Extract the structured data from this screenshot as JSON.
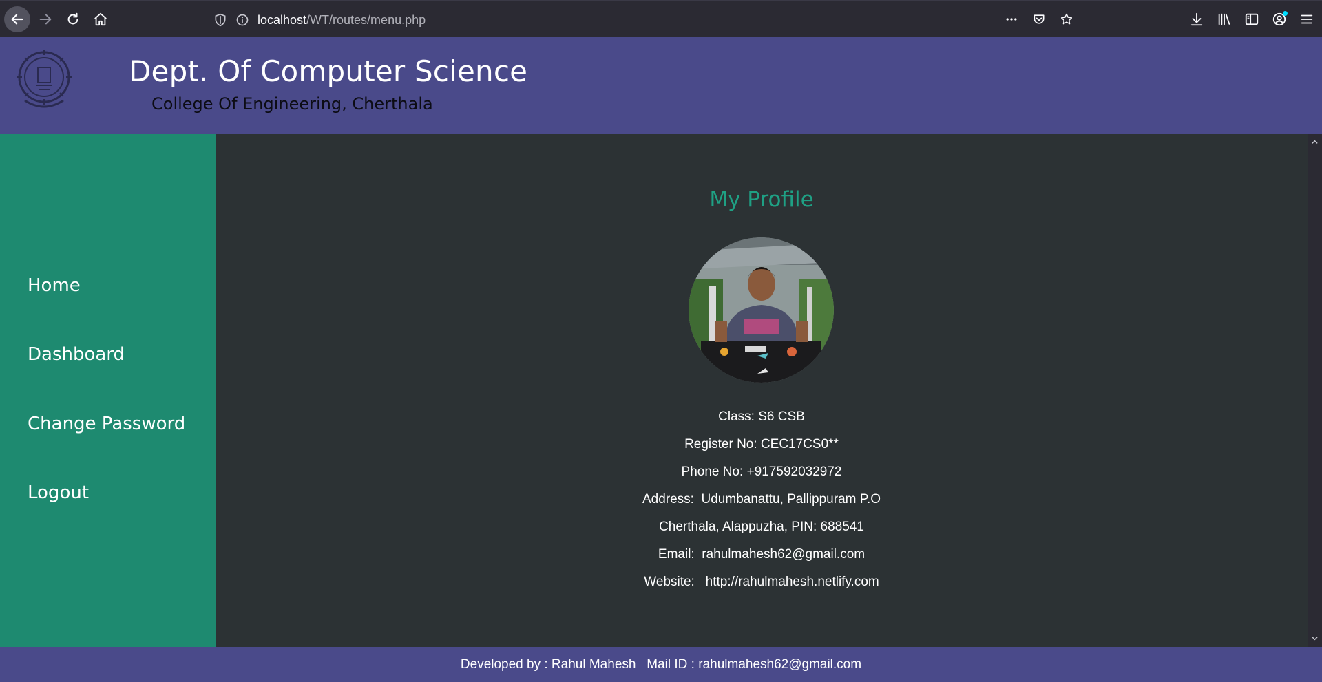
{
  "browser": {
    "url_host": "localhost",
    "url_path": "/WT/routes/menu.php"
  },
  "header": {
    "title": "Dept. Of Computer Science",
    "subtitle": "College Of Engineering, Cherthala"
  },
  "sidebar": {
    "items": [
      {
        "label": "Home"
      },
      {
        "label": "Dashboard"
      },
      {
        "label": "Change Password"
      },
      {
        "label": "Logout"
      }
    ]
  },
  "profile": {
    "heading": "My Profile",
    "lines": [
      "Class: S6 CSB",
      "Register No: CEC17CS0**",
      "Phone No: +917592032972",
      "Address:  Udumbanattu, Pallippuram P.O",
      "Cherthala, Alappuzha, PIN: 688541",
      "Email:  rahulmahesh62@gmail.com",
      "Website:   http://rahulmahesh.netlify.com"
    ]
  },
  "footer": {
    "text": "Developed by : Rahul Mahesh   Mail ID : rahulmahesh62@gmail.com"
  },
  "colors": {
    "header_bg": "#4a4a8a",
    "sidebar_bg": "#1e8a70",
    "main_bg": "#2c3234",
    "accent": "#1fa084"
  }
}
